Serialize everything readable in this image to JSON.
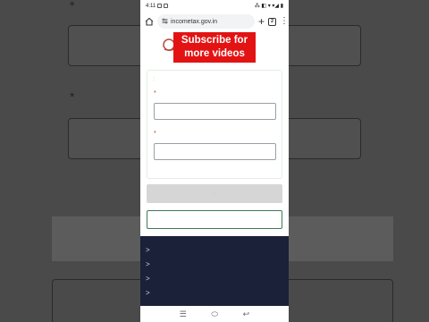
{
  "status_bar": {
    "time": "4:11",
    "icons_right": "⁂ ◧ ▾ ▾◢ ▮"
  },
  "browser": {
    "url": "incometax.gov.in",
    "tab_count": "2"
  },
  "overlay": {
    "subscribe_text": "Subscribe for more videos",
    "bg_color": "#e31313"
  },
  "form": {
    "required_marker": "*"
  },
  "footer": {
    "items": [
      ">",
      ">",
      ">",
      ">"
    ]
  },
  "nav_bar": {
    "recents_glyph": "☰",
    "home_glyph": "⬭",
    "back_glyph": "↩"
  }
}
